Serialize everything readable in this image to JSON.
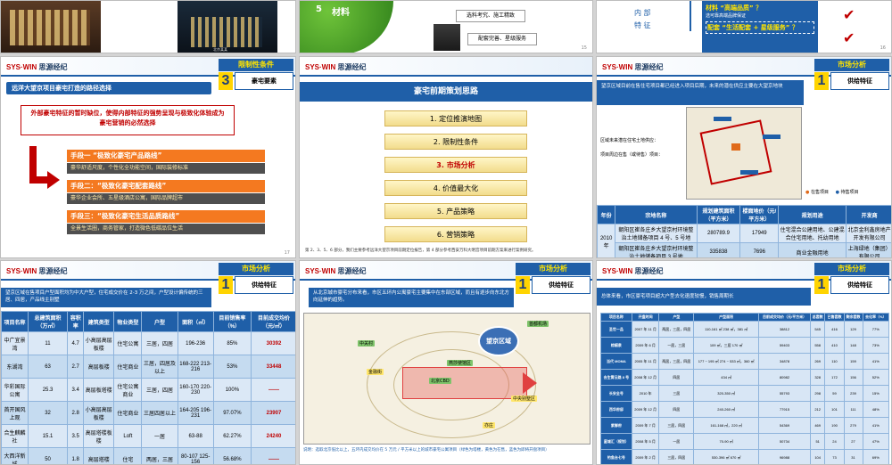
{
  "s1": {
    "caption_left": "",
    "caption_right": "北京某某"
  },
  "s2": {
    "list_num": "5",
    "list_item": "材料",
    "box1": "选料考究、施工精致",
    "box2": "配套完善、星级服务",
    "page": "15"
  },
  "s3": {
    "label1": "内 部",
    "label2": "特 征",
    "line1": "材料 “高端品质” ？",
    "line1b": "选可靠高端品牌保证",
    "line2": "配套 “生活配套 + 星级服务” ？",
    "page": "16"
  },
  "brand": {
    "en": "SYS·WIN",
    "cn": "思源经纪"
  },
  "s4": {
    "tag_title": "限制性条件",
    "tag_num": "3",
    "tag_sub": "豪宅要素",
    "banner": "远洋大望京项目豪宅打造的路径选择",
    "alert": "外部豪宅特征的暂时缺位，使得内部特征的强势呈现与极致化体验成为豪宅营销的必然选择",
    "means": [
      {
        "title": "手段一  “极致化豪宅产品路线”",
        "desc": "豪华舒适尺度，个性化全功能空间，国际装修标准"
      },
      {
        "title": "手段二：“极致化豪宅配套路线”",
        "desc": "豪华企业会所、五星级酒店公寓，国际品牌超市"
      },
      {
        "title": "手段三：“极致化豪宅生活品质路线”",
        "desc": "全景生活圈，商务管家，打造微色低碳品位生活"
      }
    ],
    "page": "17"
  },
  "s5": {
    "title": "豪宅前期策划思路",
    "steps": [
      "1. 定位推演地图",
      "2. 限制性条件",
      "3. 市场分析",
      "4. 价值最大化",
      "5. 产品策略",
      "6. 营销策略"
    ],
    "active_step": 2,
    "footer": "第 2、3、5、6 部分，我们主要参考远洋大望京项目前期定位报告，第 4 部分参考西安万科大明宫项目前期方案来进行案例研究。",
    "page": ""
  },
  "s6": {
    "tag_title": "市场分析",
    "tag_num": "1",
    "tag_sub": "供给特征",
    "intro": "望京区域目前在售住宅项目都已经进入项目后期，未来的潜在供应主要在大望京地块",
    "note1": "区域未来潜在住宅土地供应：",
    "note2": "项目周边在售（或待售）项目：",
    "legend1": "在售项目",
    "legend2": "待售项目",
    "table_head": [
      "年份",
      "宗地名称",
      "规划建筑面积（平方米）",
      "楼面地价（元/平方米）",
      "规划用途",
      "开发商"
    ],
    "year": "2010 年",
    "rows": [
      [
        "朝阳区崔各庄乡大望京村环境整治土地储备项目 4 号、5 号地",
        "280789.9",
        "17949",
        "住宅混合公建用地、公建混合住宅用地、托幼用地",
        "北京金利鑫房地产开发有限公司"
      ],
      [
        "朝阳区崔各庄乡大望京村环境整治土地储备项目 3 号地",
        "335838",
        "7696",
        "商业金融用地",
        "上海绿地（集团）有限公司"
      ]
    ]
  },
  "s7": {
    "tag_title": "市场分析",
    "tag_num": "1",
    "tag_sub": "供给特征",
    "intro": "望京区域在售项目户型面积均为中大户型，住宅成交价在 2-3 万之间，户型设计偏传统的三居、四居，产品线主别墅",
    "head": [
      "项目名称",
      "总建筑面积（万㎡）",
      "容积率",
      "建筑类型",
      "物业类型",
      "户型",
      "面积（㎡）",
      "目前销售率（%）",
      "目前成交均价（元/㎡）"
    ],
    "rows": [
      [
        "中广宜景湾",
        "11",
        "4.7",
        "小高层高层板楼",
        "住宅公寓",
        "三居，四居",
        "196-236",
        "85%",
        "30392"
      ],
      [
        "东湖湾",
        "63",
        "2.7",
        "高层板楼",
        "住宅商业",
        "三居，四居及以上",
        "168-222 213-216",
        "53%",
        "33448"
      ],
      [
        "华彩国际公寓",
        "25.3",
        "3.4",
        "高层板塔楼",
        "住宅公寓商业",
        "三居，四居",
        "160-170 220-230",
        "100%",
        "——"
      ],
      [
        "首开国风上观",
        "32",
        "2.8",
        "小高层高层板楼",
        "住宅商业",
        "三居四居以上",
        "164-205 196-231",
        "97.07%",
        "23907"
      ],
      [
        "合生麒麟社",
        "15.1",
        "3.5",
        "高层塔楼板楼",
        "Loft",
        "一居",
        "63-88",
        "62.27%",
        "24240"
      ],
      [
        "大西洋新城",
        "50",
        "1.8",
        "高层塔楼",
        "住宅",
        "两居，三居",
        "80-107 125-156",
        "56.68%",
        "——"
      ]
    ]
  },
  "s8": {
    "tag_title": "市场分析",
    "tag_num": "1",
    "tag_sub": "供给特征",
    "intro": "从北京城市豪宅分布来看，市区五环内公寓豪宅主要集中在东部区域，而且有逐步向东北方向延伸的趋势。",
    "hub": "望京区域",
    "labels": [
      "首都机场",
      "望京区域",
      "北京CBD",
      "中央别墅区",
      "燕莎使馆区",
      "金融街",
      "中关村",
      "亦庄"
    ],
    "note": "说明：选取北京低比以上，五环内成交均价在 5 万元 / 平方米以上的城市豪宅公寓项目（绿色为塔楼，黄色为在售，蓝色为即将开盘项目）"
  },
  "s9": {
    "tag_title": "市场分析",
    "tag_num": "1",
    "tag_sub": "供给特征",
    "intro": "总体来看，市区豪宅项目超大户型去化速度较慢，销售周期长",
    "head": [
      "项目名称",
      "开盘时间",
      "户型",
      "户型面积",
      "目前成交均价（元/平方米）",
      "总套数",
      "已售套数",
      "剩余套数",
      "去化率（%）"
    ],
    "rows": [
      [
        "圣世一品",
        "2007 年 11 月",
        "两居，三居，四居",
        "110-161 ㎡ 238 ㎡，381 ㎡",
        "38812",
        "545",
        "416",
        "129",
        "77%"
      ],
      [
        "棕榈泉",
        "2009 年 6 月",
        "一居，三居",
        "109 ㎡，三居 170 ㎡",
        "59403",
        "558",
        "410",
        "148",
        "73%"
      ],
      [
        "当代 MOMA",
        "2005 年 11 月",
        "两居，三居，四居",
        "177 ~ 195 ㎡ 274 ~ 533 ㎡，360 ㎡",
        "34878",
        "269",
        "110",
        "159",
        "41%"
      ],
      [
        "合生霄云路 8 号",
        "2008 年 12 月",
        "四居",
        "434 ㎡",
        "80982",
        "328",
        "172",
        "156",
        "52%"
      ],
      [
        "长安全号",
        "2010 年",
        "三居",
        "320-350 ㎡",
        "55793",
        "298",
        "59",
        "239",
        "15%"
      ],
      [
        "西华府邸",
        "2009 年 12 月",
        "四居",
        "240-260 ㎡",
        "77915",
        "212",
        "101",
        "111",
        "48%"
      ],
      [
        "紫御府",
        "2009 年 7 月",
        "三居，四居",
        "161-168 ㎡，220 ㎡",
        "54369",
        "469",
        "190",
        "279",
        "41%"
      ],
      [
        "星城汇（规划）",
        "2008 年 5 月",
        "一居",
        "70-90 ㎡",
        "50734",
        "51",
        "24",
        "27",
        "47%"
      ],
      [
        "钓鱼台七号",
        "2009 年 2 月",
        "三居，四居",
        "530-396 ㎡ 670 ㎡",
        "96988",
        "104",
        "73",
        "31",
        "69%"
      ]
    ]
  },
  "colors": {
    "navy": "#1f5fa8",
    "orange": "#f47920",
    "red": "#c00000",
    "yellow": "#ffd400"
  }
}
